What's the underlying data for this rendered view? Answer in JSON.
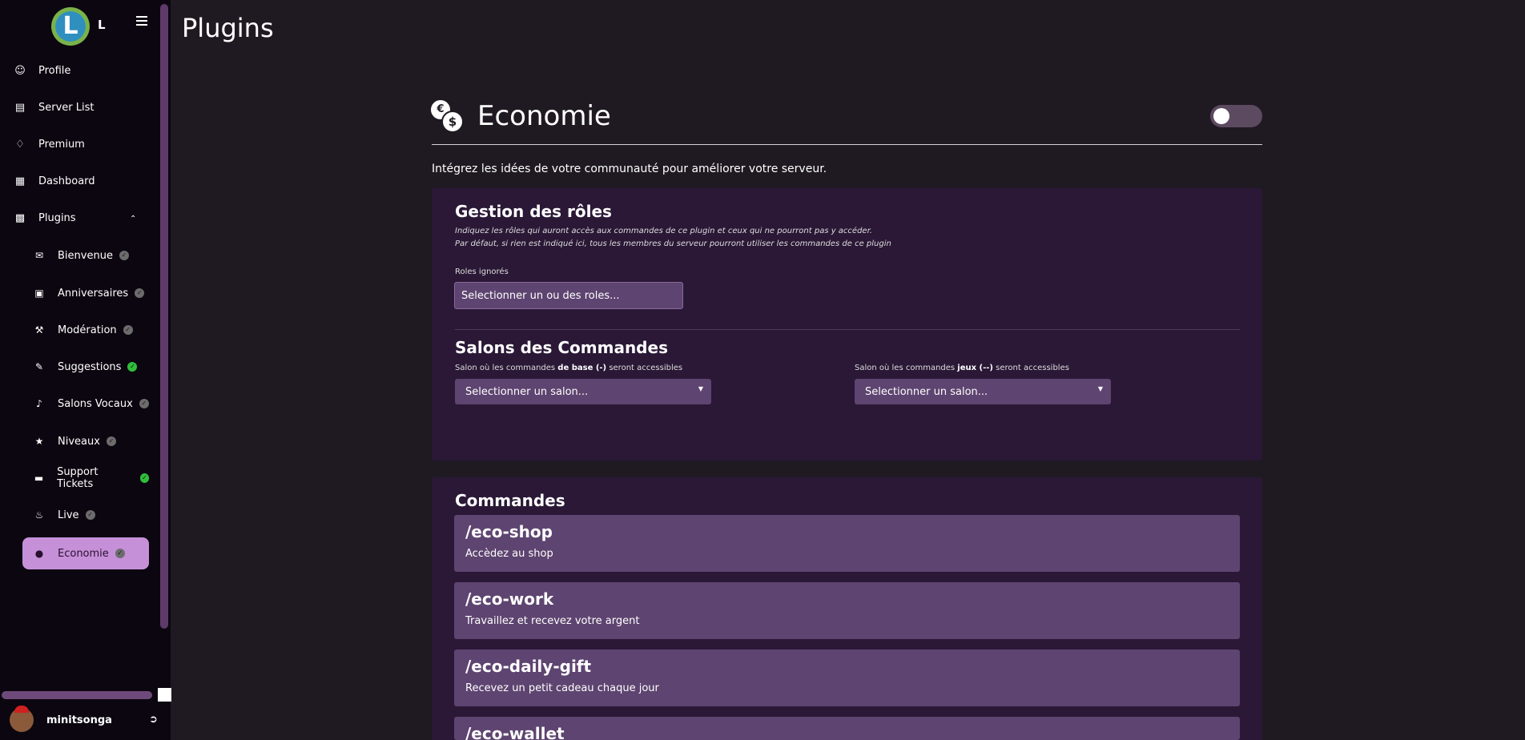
{
  "sidebar": {
    "brand_logo_letter": "L",
    "brand_letter": "L",
    "items": [
      {
        "label": "Profile",
        "icon": "user-icon"
      },
      {
        "label": "Server List",
        "icon": "server-icon"
      },
      {
        "label": "Premium",
        "icon": "diamond-icon"
      },
      {
        "label": "Dashboard",
        "icon": "dashboard-icon"
      },
      {
        "label": "Plugins",
        "icon": "plugins-icon"
      }
    ],
    "plugins": [
      {
        "label": "Bienvenue",
        "icon": "megaphone-icon",
        "enabled": false
      },
      {
        "label": "Anniversaires",
        "icon": "calendar-icon",
        "enabled": false
      },
      {
        "label": "Modération",
        "icon": "gavel-icon",
        "enabled": false
      },
      {
        "label": "Suggestions",
        "icon": "edit-icon",
        "enabled": true
      },
      {
        "label": "Salons Vocaux",
        "icon": "microphone-icon",
        "enabled": false
      },
      {
        "label": "Niveaux",
        "icon": "trophy-icon",
        "enabled": false
      },
      {
        "label": "Support Tickets",
        "icon": "ticket-icon",
        "enabled": true
      },
      {
        "label": "Live",
        "icon": "bell-icon",
        "enabled": false
      },
      {
        "label": "Economie",
        "icon": "coins-icon",
        "enabled": false,
        "active": true
      }
    ],
    "user": {
      "name": "minitsonga"
    }
  },
  "page": {
    "title": "Plugins"
  },
  "plugin": {
    "title": "Economie",
    "icon_symbols": {
      "coin_back": "€",
      "coin_front": "$"
    },
    "description": "Intégrez les idées de votre communauté pour améliorer votre serveur.",
    "enabled": false
  },
  "roles": {
    "title": "Gestion des rôles",
    "help1": "Indiquez les rôles qui auront accès aux commandes de ce plugin et ceux qui ne pourront pas y accéder.",
    "help2": "Par défaut, si rien est indiqué ici, tous les membres du serveur pourront utiliser les commandes de ce plugin",
    "ignored_label": "Roles ignorés",
    "ignored_placeholder": "Selectionner un ou des roles..."
  },
  "channels": {
    "title": "Salons des Commandes",
    "base_label_pre": "Salon où les commandes ",
    "base_label_bold": "de base (-)",
    "base_label_post": " seront accessibles",
    "base_value": "Selectionner un salon...",
    "games_label_pre": "Salon où les commandes ",
    "games_label_bold": "jeux (--)",
    "games_label_post": " seront accessibles",
    "games_value": "Selectionner un salon..."
  },
  "commands": {
    "title": "Commandes",
    "items": [
      {
        "name": "/eco-shop",
        "desc": "Accèdez au shop"
      },
      {
        "name": "/eco-work",
        "desc": "Travaillez et recevez votre argent"
      },
      {
        "name": "/eco-daily-gift",
        "desc": "Recevez un petit cadeau chaque jour"
      },
      {
        "name": "/eco-wallet",
        "desc": ""
      }
    ]
  },
  "colors": {
    "background": "#1f1a22",
    "sidebar": "#0c0610",
    "panel": "#2a1836",
    "accent": "#c690d8",
    "field": "#5e4470",
    "enabled_check": "#2fbf3a"
  }
}
